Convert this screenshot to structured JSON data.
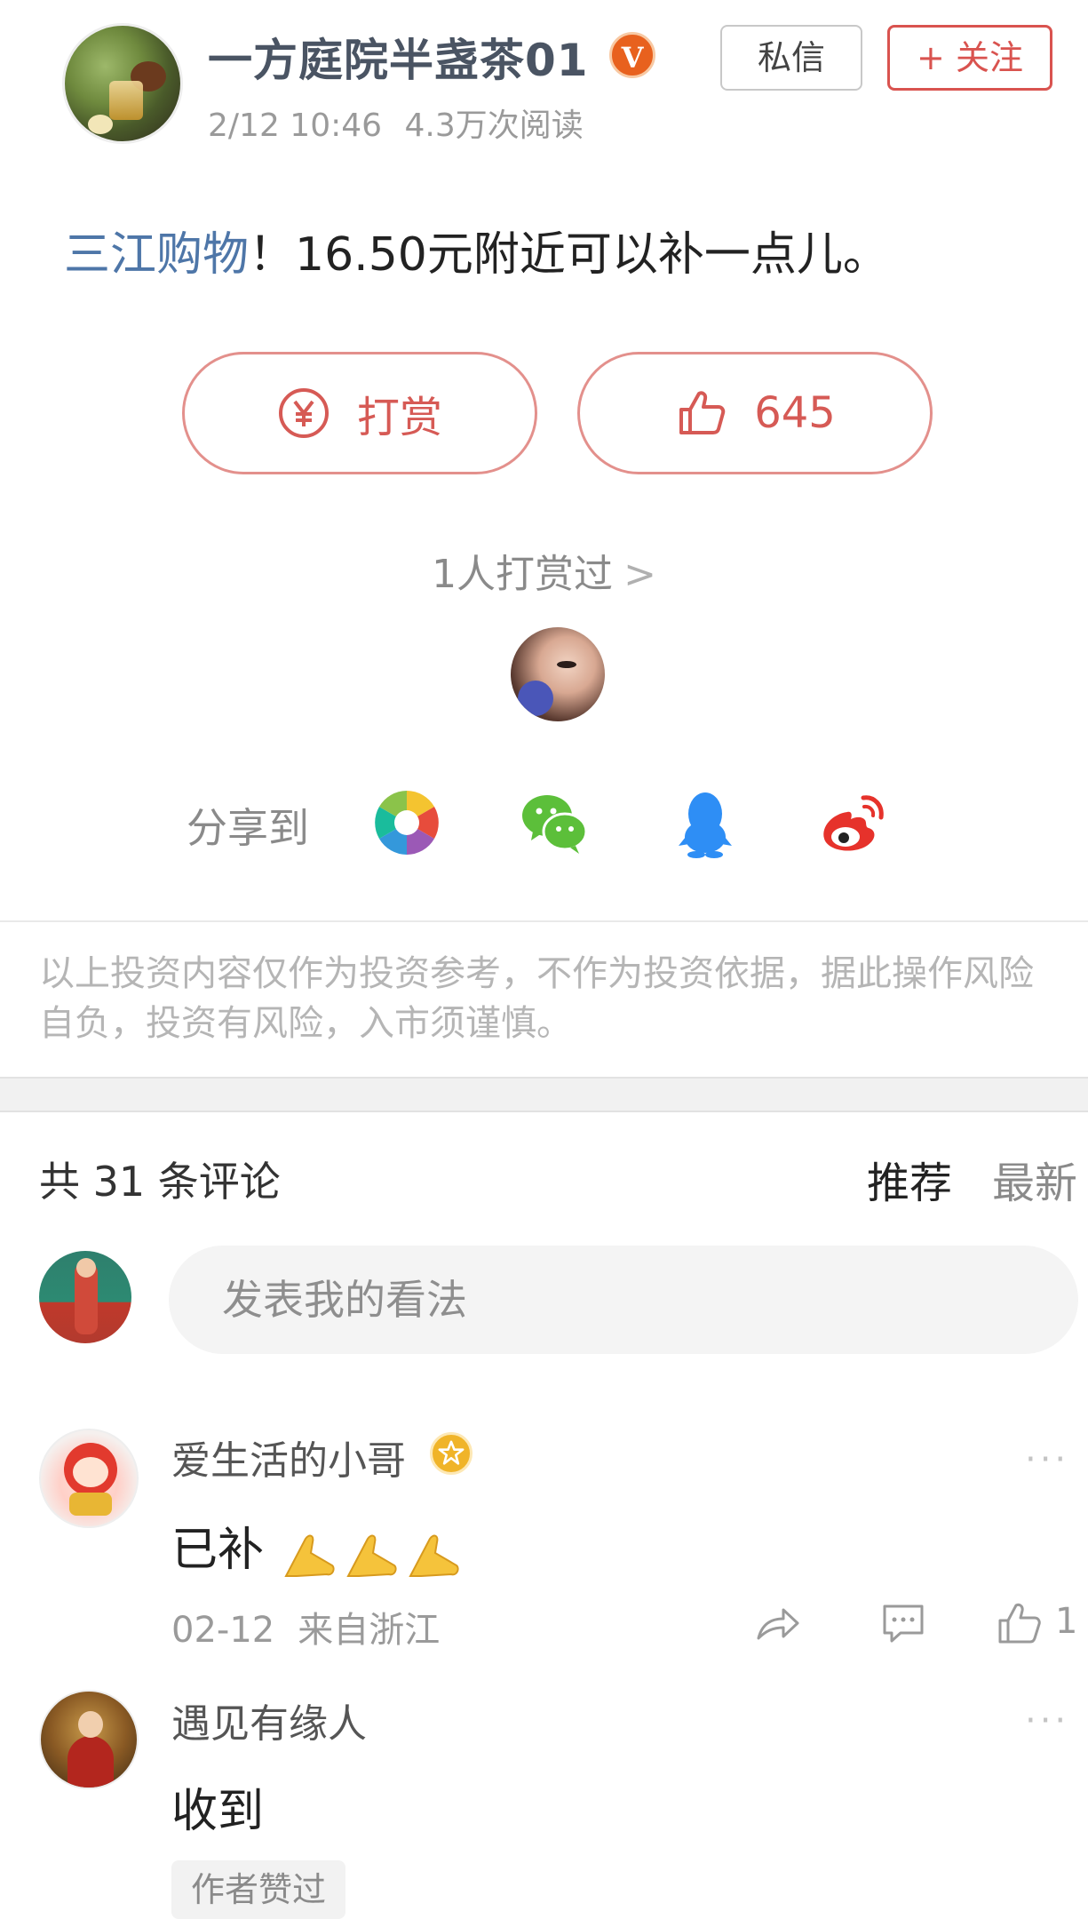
{
  "header": {
    "author_name": "一方庭院半盏茶01",
    "verified_badge": "V",
    "timestamp": "2/12 10:46",
    "read_count": "4.3万次阅读",
    "dm_label": "私信",
    "follow_label": "+ 关注"
  },
  "post": {
    "link_text": "三江购物",
    "body_text": "！16.50元附近可以补一点儿。"
  },
  "actions": {
    "tip_label": "打赏",
    "tip_icon": "yen-circle-icon",
    "like_count": "645",
    "like_icon": "thumbs-up-icon"
  },
  "tippers": {
    "label": "1人打赏过",
    "chevron": ">"
  },
  "share": {
    "label": "分享到",
    "targets": [
      "moments-icon",
      "wechat-icon",
      "qq-icon",
      "weibo-icon"
    ]
  },
  "disclaimer": "以上投资内容仅作为投资参考，不作为投资依据，据此操作风险自负，投资有风险，入市须谨慎。",
  "comments_header": {
    "count_text": "共 31 条评论",
    "sort_recommended": "推荐",
    "sort_latest": "最新"
  },
  "comment_input": {
    "placeholder": "发表我的看法"
  },
  "comments": [
    {
      "name": "爱生活的小哥",
      "text": "已补",
      "date": "02-12",
      "location": "来自浙江",
      "likes": "1",
      "more": "···"
    },
    {
      "name": "遇见有缘人",
      "text": "收到",
      "badge": "作者赞过",
      "more": "···"
    }
  ],
  "colors": {
    "accent_red": "#d9534f",
    "link_blue": "#4e76a8",
    "verified_orange": "#e8611e",
    "muted_gray": "#9a9a9a"
  }
}
